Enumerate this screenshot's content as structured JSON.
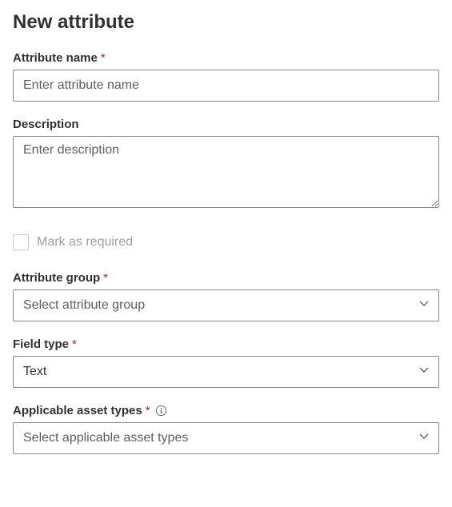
{
  "page": {
    "title": "New attribute"
  },
  "fields": {
    "attributeName": {
      "label": "Attribute name",
      "placeholder": "Enter attribute name",
      "required": true
    },
    "description": {
      "label": "Description",
      "placeholder": "Enter description",
      "required": false
    },
    "markRequired": {
      "label": "Mark as required",
      "checked": false
    },
    "attributeGroup": {
      "label": "Attribute group",
      "placeholder": "Select attribute group",
      "required": true
    },
    "fieldType": {
      "label": "Field type",
      "value": "Text",
      "required": true
    },
    "applicableAssetTypes": {
      "label": "Applicable asset types",
      "placeholder": "Select applicable asset types",
      "required": true
    }
  }
}
